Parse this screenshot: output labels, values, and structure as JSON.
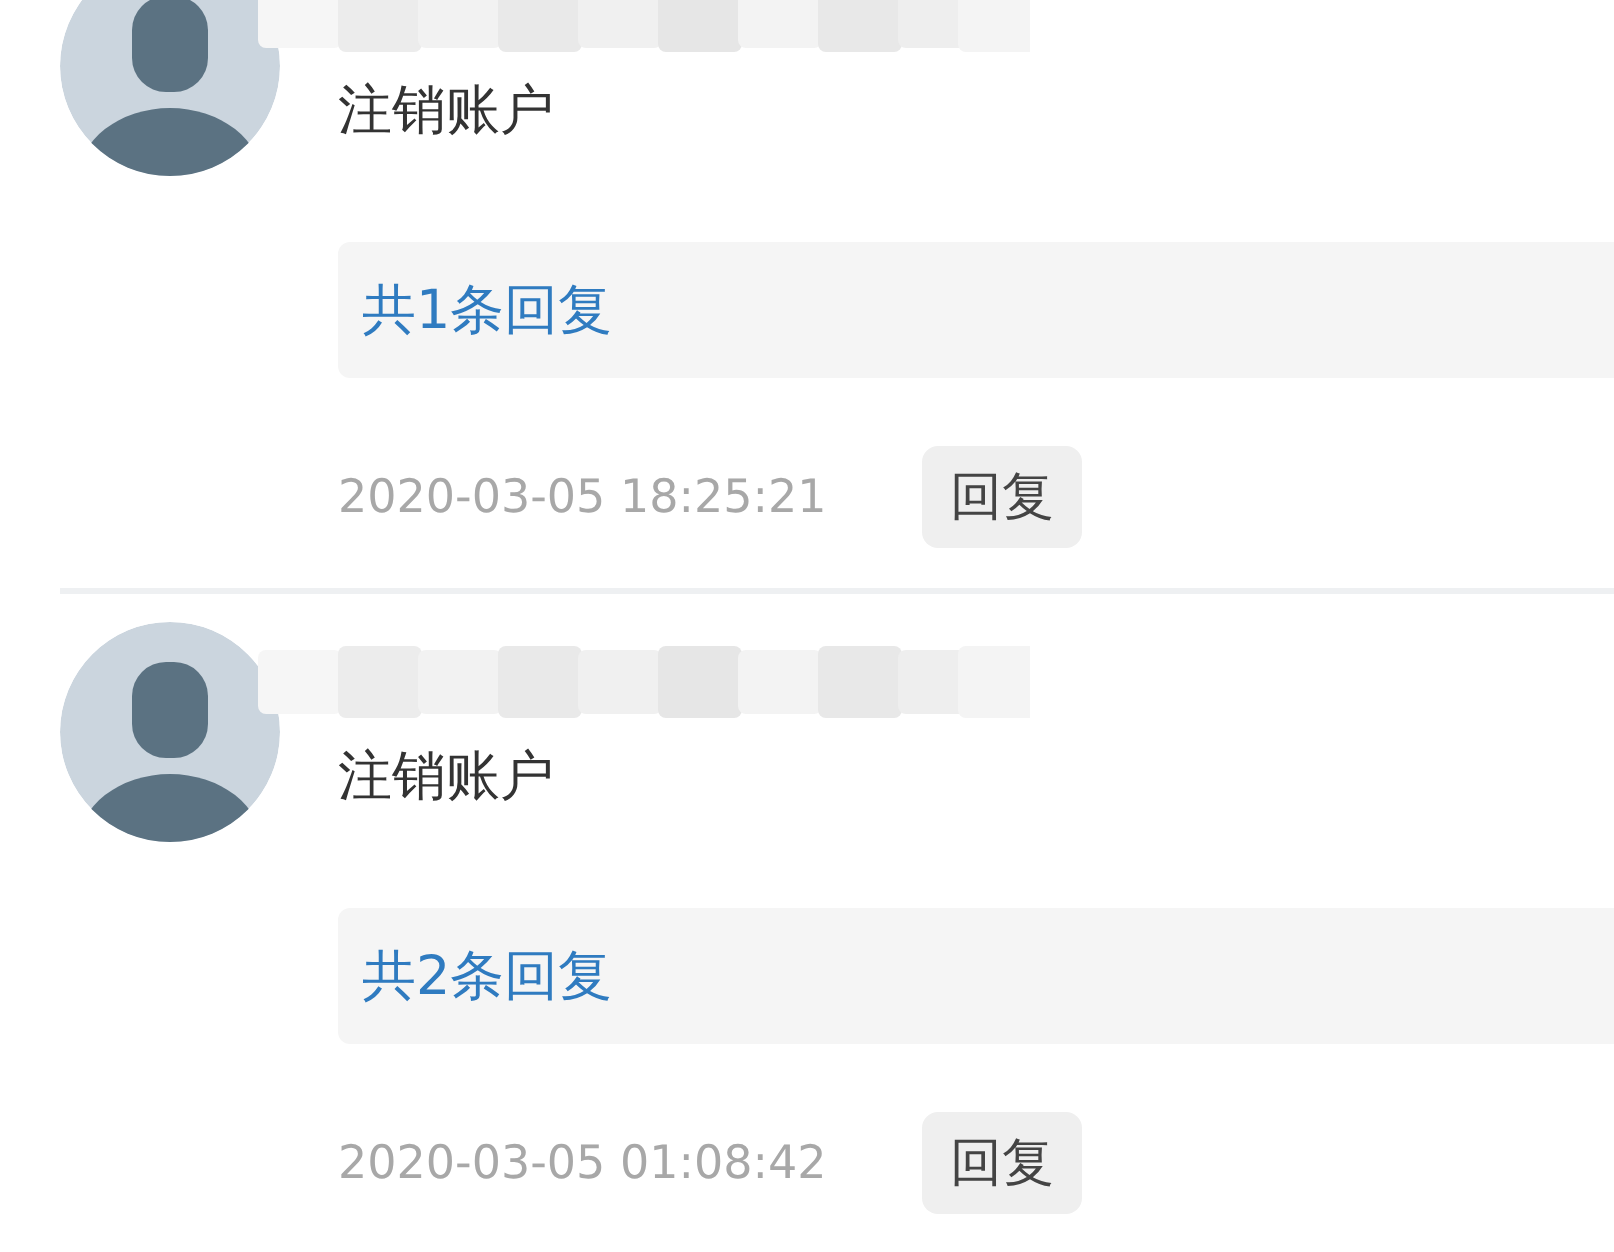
{
  "comments": [
    {
      "name": "注销账户",
      "replies_link": "共1条回复",
      "time": "2020-03-05 18:25:21",
      "reply_button": "回复"
    },
    {
      "name": "注销账户",
      "replies_link": "共2条回复",
      "time": "2020-03-05 01:08:42",
      "reply_button": "回复"
    }
  ]
}
